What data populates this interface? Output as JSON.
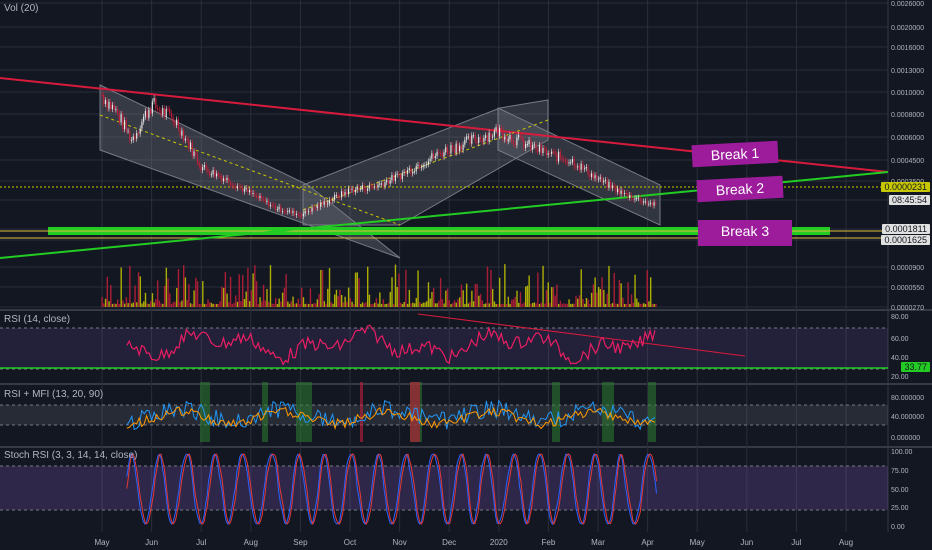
{
  "panes": {
    "main_title": "Vol (20)",
    "rsi_title": "RSI (14, close)",
    "mfi_title": "RSI + MFI (13, 20, 90)",
    "stoch_title": "Stoch RSI (3, 3, 14, 14, close)"
  },
  "labels": {
    "break1": "Break 1",
    "break2": "Break 2",
    "break3": "Break 3",
    "price_current": "0.0000231",
    "countdown": "08:45:54",
    "price_level_a": "0.0001811",
    "price_level_b": "0.0001625",
    "rsi_current": "33.77"
  },
  "colors": {
    "background": "#131722",
    "grid": "#2a2e39",
    "up": "#c8c800",
    "down": "#c41e3a",
    "rsi_line": "#e91e63",
    "trend_red": "#d81b3c",
    "trend_green": "#22cc22",
    "break_box": "#9c1c9c",
    "mfi_blue": "#2196f3",
    "mfi_orange": "#ff9800",
    "stoch_blue": "#2962ff",
    "stoch_red": "#e53935"
  },
  "axes": {
    "x_ticks": [
      "May",
      "Jun",
      "Jul",
      "Aug",
      "Sep",
      "Oct",
      "Nov",
      "Dec",
      "2020",
      "Feb",
      "Mar",
      "Apr",
      "May",
      "Jun",
      "Jul",
      "Aug"
    ],
    "main_y_ticks": [
      "0.0026000",
      "0.0020000",
      "0.0016000",
      "0.0013000",
      "0.0010000",
      "0.0008000",
      "0.0006000",
      "0.0004500",
      "0.0003500",
      "0.0002500",
      "0.0001811",
      "0.0001625",
      "0.0000900",
      "0.0000550",
      "0.0000270"
    ],
    "rsi_y_ticks": [
      "80.00",
      "60.00",
      "40.00",
      "20.00"
    ],
    "mfi_y_ticks": [
      "80.000000",
      "40.000000",
      "0.000000"
    ],
    "stoch_y_ticks": [
      "100.00",
      "75.00",
      "50.00",
      "25.00",
      "0.00"
    ]
  },
  "chart_data": {
    "type": "candlestick",
    "x_months": [
      "May",
      "Jun",
      "Jul",
      "Aug",
      "Sep",
      "Oct",
      "Nov",
      "Dec",
      "2020",
      "Feb",
      "Mar",
      "Apr"
    ],
    "price_path": [
      [
        0,
        0.00085
      ],
      [
        0.3,
        0.00075
      ],
      [
        0.6,
        0.0006
      ],
      [
        1.0,
        0.0008
      ],
      [
        1.5,
        0.0007
      ],
      [
        2.0,
        0.00045
      ],
      [
        2.5,
        0.00038
      ],
      [
        3.0,
        0.0003
      ],
      [
        3.5,
        0.00022
      ],
      [
        4.0,
        0.00018
      ],
      [
        4.5,
        0.00025
      ],
      [
        5.0,
        0.00032
      ],
      [
        5.5,
        0.00034
      ],
      [
        6.0,
        0.0004
      ],
      [
        6.5,
        0.00048
      ],
      [
        7.0,
        0.00055
      ],
      [
        7.5,
        0.0006
      ],
      [
        8.0,
        0.00065
      ],
      [
        8.5,
        0.00058
      ],
      [
        9.0,
        0.00052
      ],
      [
        9.5,
        0.00048
      ],
      [
        10.0,
        0.00038
      ],
      [
        10.5,
        0.0003
      ],
      [
        11.0,
        0.00025
      ],
      [
        11.2,
        0.000231
      ]
    ],
    "levels": [
      "0.0001811",
      "0.0001625"
    ],
    "rsi_current": 33.77,
    "rsi_bands": [
      70,
      30
    ],
    "stoch_bands": [
      80,
      20
    ]
  }
}
